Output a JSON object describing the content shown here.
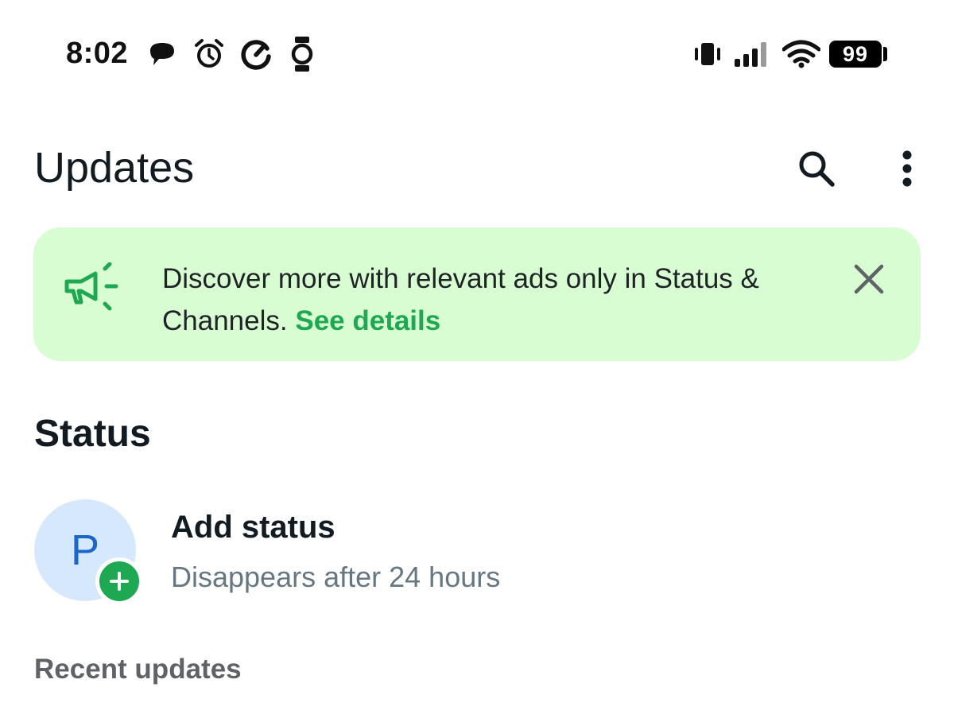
{
  "status_bar": {
    "time": "8:02",
    "battery": "99",
    "icons": [
      "chat-bubble-icon",
      "alarm-icon",
      "sync-icon",
      "watch-icon",
      "vibrate-icon",
      "signal-icon",
      "wifi-icon",
      "battery-icon"
    ]
  },
  "header": {
    "title": "Updates",
    "search_icon": "search-icon",
    "menu_icon": "more-vert-icon"
  },
  "banner": {
    "text": "Discover more with relevant ads only in Status & Channels.",
    "link": "See details",
    "icon": "megaphone-icon",
    "close_icon": "close-icon",
    "background": "#d9fdd3",
    "accent": "#1da851"
  },
  "status_section": {
    "title": "Status",
    "my_status": {
      "avatar_letter": "P",
      "title": "Add status",
      "subtitle": "Disappears after 24 hours"
    }
  },
  "recent": {
    "title": "Recent updates"
  }
}
